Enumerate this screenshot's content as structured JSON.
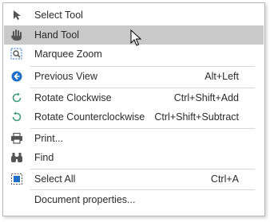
{
  "menu": {
    "items": [
      {
        "label": "Select Tool",
        "shortcut": "",
        "icon": "arrow-cursor-icon"
      },
      {
        "label": "Hand Tool",
        "shortcut": "",
        "icon": "hand-icon"
      },
      {
        "label": "Marquee Zoom",
        "shortcut": "",
        "icon": "marquee-zoom-icon"
      },
      {
        "label": "Previous View",
        "shortcut": "Alt+Left",
        "icon": "previous-view-icon"
      },
      {
        "label": "Rotate Clockwise",
        "shortcut": "Ctrl+Shift+Add",
        "icon": "rotate-clockwise-icon"
      },
      {
        "label": "Rotate Counterclockwise",
        "shortcut": "Ctrl+Shift+Subtract",
        "icon": "rotate-counterclockwise-icon"
      },
      {
        "label": "Print...",
        "shortcut": "",
        "icon": "printer-icon"
      },
      {
        "label": "Find",
        "shortcut": "",
        "icon": "binoculars-icon"
      },
      {
        "label": "Select All",
        "shortcut": "Ctrl+A",
        "icon": "select-all-icon"
      },
      {
        "label": "Document properties...",
        "shortcut": "",
        "icon": ""
      }
    ],
    "hovered_item": "Hand Tool"
  },
  "colors": {
    "hover_background": "#c9c9c9",
    "accent_blue": "#1e6fc7",
    "icon_gray": "#555555",
    "rotate_green": "#3c9b7a"
  }
}
